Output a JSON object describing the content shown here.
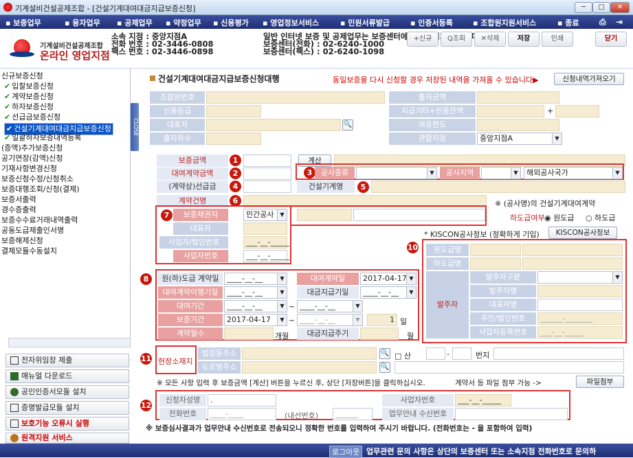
{
  "window": {
    "title": "기계설비건설공제조합 - [건설기계대여대금지급보증신청]",
    "btn_min": "─",
    "btn_max": "□",
    "btn_close": "✕"
  },
  "menu": [
    "▪ 보증업무",
    "▪ 융자업무",
    "▪ 공제업무",
    "▪ 약정업무",
    "▪ 신용평가",
    "▪ 영업정보서비스",
    "▪ 민원서류발급",
    "▪ 인증서등록",
    "▪ 조합원지원서비스",
    "▪ 종료"
  ],
  "menu_icons": {
    "print": "⎙",
    "exit": "⇥"
  },
  "header": {
    "brand_line1": "기계설비건설공제조합",
    "brand_line2": "온라인 영업지점",
    "info_l1": "소속 지점 : 중앙지점A",
    "info_l2": "전화 번호 : 02-3446-0808",
    "info_l3": "팩스 번호 : 02-3446-0898",
    "info_r1": "일반 인터넷 보증 및 공제업무는 보증센터에 문의하시기 바랍니다.",
    "info_r2": "보증센터(전화) : 02-6240-1000",
    "info_r3": "보증센터(팩스) : 02-6240-1098",
    "btn_new": "+신규",
    "btn_search": "Q조회",
    "btn_delete": "✕삭제",
    "btn_save": "저장",
    "btn_print": "인쇄",
    "btn_close": "닫기"
  },
  "sidebar": {
    "items": [
      "신규보증신청",
      "입찰보증신청",
      "계약보증신청",
      "하자보증신청",
      "선급금보증신청",
      "건설기계대여대금지급보증신청",
      "일괄하자보증내역등록",
      "(증액)추가보증신청",
      "공기연장(감액)신청",
      "기재사항변경신청",
      "보증신청수정/신청취소",
      "보증대행조회/신청(결제)",
      "보증서출력",
      "경수증출력",
      "보증수수료거래내역출력",
      "공동도급제출인서명",
      "보증해제신청",
      "결제모듈수동설치"
    ],
    "close_tab": "CLOSE",
    "buttons": [
      "전자위임장 제출",
      "매뉴얼 다운로드",
      "공인인증서모듈 설치",
      "증명발급모듈 설치",
      "보호기능 오류시 실행",
      "원격지원 서비스"
    ]
  },
  "main": {
    "title": "건설기계대여대금지급보증신청대행",
    "notice": "동일보증을 다시 신청할 경우 저장된 내역을 가져올 수 있습니다▶",
    "fetch_btn": "신청내역가져오기",
    "top": {
      "member_no": "조합원번호",
      "credit_grade": "신용등급",
      "ceo": "대표자",
      "investors": "출자좌수",
      "invest_amt": "출자금액",
      "pay_balance": "지급기타+전용잔액",
      "margin_limit": "여유한도",
      "branch": "관할지점",
      "branch_val": "중앙지점A",
      "plus": "+"
    },
    "guar_amount": "보증금액",
    "calc_btn": "계산",
    "rental_amount": "대여계약금액",
    "advance": "(계약상)선급금",
    "work_type": "공사종류",
    "work_region": "공사지역",
    "overseas": "해외공사국가",
    "machine_name": "건설기계명",
    "contract_name": "계약건명",
    "contract_suffix": "※ (공사명)의 건설기계대여계약",
    "creditor": "보증채권자",
    "creditor_val": "민간공사",
    "ceo2": "대표자",
    "bizno": "사업자/법인번호",
    "bizno_val": "___-__-_____",
    "biz_no2": "사업자번호",
    "biz_no2_val": "___-__-_____",
    "subcontract": "하도급여부",
    "opt_main": "원도급",
    "opt_sub": "하도급",
    "kiscon_note": "* KISCON공사정보 (정확하게 기입)",
    "kiscon_btn": "KISCON공사정보",
    "main_contractor": "원도급명",
    "sub_contractor": "하도급명",
    "orderer": "발주자",
    "orderer_type": "발주자구분",
    "orderer_name": "발주자명",
    "ceo_name": "대표자명",
    "resid_no": "주민/법인번호",
    "biz_reg_no": "사업자등록번호",
    "resid_ph": "______-_______",
    "bizreg_ph": "___-__-_____",
    "date_ph": "____-__-__",
    "sub_contract_date": "원(하)도급 계약일",
    "rental_contract_date": "대여계약일",
    "rental_contract_date_val": "2017-04-17",
    "rental_perform_date": "대여계약이행기일",
    "payment_due": "대금지급기일",
    "rental_period": "대여기간",
    "guar_period": "보증기간",
    "guar_start": "2017-04-17",
    "guar_days": "1",
    "day_unit": "일",
    "contract_months": "계약월수",
    "months_unit": "개월",
    "pay_cycle": "대금지급주기",
    "cycle_unit": "월",
    "tilde": "~",
    "site_location": "현장소재지",
    "addr_lot": "법정동주소",
    "addr_road": "도로명주소",
    "san": "산",
    "dash": "-",
    "lot_no": "번지",
    "bottom_note": "※ 모든 사항 입력 후 보증금액 [계산] 버튼을 누르신 후, 상단 [저장버튼]을 클릭하십시오.",
    "attach_note": "계약서 등 파일 첨부 가능 ->",
    "attach_btn": "파일첨부",
    "applicant": "신청자성명",
    "phone": "전화번호",
    "ext_label": "(내선번호)",
    "ext_val": "______",
    "phone_val": "____-____",
    "applicant_val": ".",
    "biz_no3": "사업자번호",
    "biz_no3_val": "___-__-_____",
    "fax_recv": "업무안내 수신번호",
    "final_note": "※ 보증심사결과가 업무안내 수신번호로 전송되오니 정확한 번호를 입력하여 주시기 바랍니다. (전화번호는 - 을 포함하여 입력)"
  },
  "markers": [
    "1",
    "2",
    "3",
    "4",
    "5",
    "6",
    "7",
    "8",
    "9",
    "10",
    "11",
    "12"
  ],
  "statusbar": {
    "logout": "로그아웃",
    "msg": "업무관련 문의 사항은 상단의 보증센터 또는 소속지점 전화번호로 문의하"
  },
  "icons": {
    "dropdown": "▼",
    "search": "🔍",
    "checkmark": "✔",
    "arrow": "▸"
  }
}
